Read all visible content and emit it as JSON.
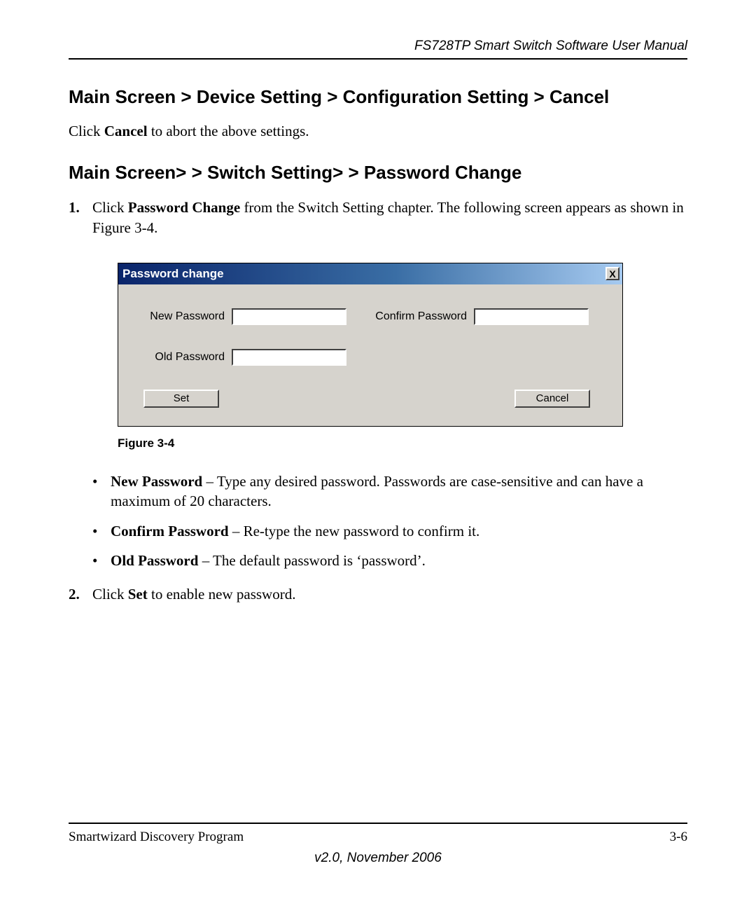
{
  "header": {
    "doc_title": "FS728TP Smart Switch Software User Manual"
  },
  "section1": {
    "heading": "Main Screen > Device Setting > Configuration Setting > Cancel",
    "para_pre": "Click ",
    "para_bold": "Cancel",
    "para_post": " to abort the above settings."
  },
  "section2": {
    "heading": "Main Screen> > Switch Setting> > Password Change",
    "step1_num": "1.",
    "step1_pre": "Click ",
    "step1_bold": "Password Change",
    "step1_post": " from the Switch Setting chapter. The following screen appears as shown in Figure 3-4."
  },
  "dialog": {
    "title": "Password change",
    "close_glyph": "X",
    "labels": {
      "new_password": "New Password",
      "confirm_password": "Confirm Password",
      "old_password": "Old Password"
    },
    "buttons": {
      "set": "Set",
      "cancel": "Cancel"
    }
  },
  "figure_caption": "Figure 3-4",
  "bullets": {
    "b1_bold": "New Password",
    "b1_rest": " – Type any desired password. Passwords are case-sensitive and can have a maximum of 20 characters.",
    "b2_bold": "Confirm Password",
    "b2_rest": " – Re-type the new password to confirm it.",
    "b3_bold": "Old Password",
    "b3_rest": " – The default password is ‘password’."
  },
  "step2": {
    "num": "2.",
    "pre": "Click ",
    "bold": "Set",
    "post": " to enable new password."
  },
  "footer": {
    "left": "Smartwizard Discovery Program",
    "right": "3-6",
    "version": "v2.0, November 2006"
  }
}
